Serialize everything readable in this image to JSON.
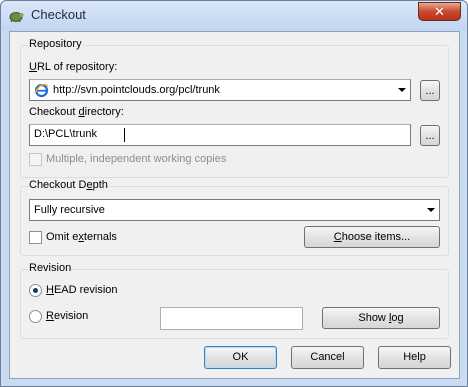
{
  "window": {
    "title": "Checkout",
    "close_glyph": "✕",
    "app_icon": "tortoise-svn-icon"
  },
  "repository": {
    "group_title": "Repository",
    "url_label": "URL of repository:",
    "url_value": "http://svn.pointclouds.org/pcl/trunk",
    "url_icon": "internet-explorer-icon",
    "browse_url_label": "...",
    "dir_label": "Checkout directory:",
    "dir_value": "D:\\PCL\\trunk",
    "browse_dir_label": "...",
    "multiple_wc_label": "Multiple, independent working copies",
    "multiple_wc_checked": false
  },
  "depth": {
    "group_title": "Checkout Depth",
    "selected": "Fully recursive",
    "omit_externals_label": "Omit externals",
    "omit_externals_checked": false,
    "choose_items_label": "Choose items..."
  },
  "revision": {
    "group_title": "Revision",
    "head_label": "HEAD revision",
    "head_selected": true,
    "revision_label": "Revision",
    "revision_value": "",
    "show_log_label": "Show log"
  },
  "buttons": {
    "ok": "OK",
    "cancel": "Cancel",
    "help": "Help"
  }
}
